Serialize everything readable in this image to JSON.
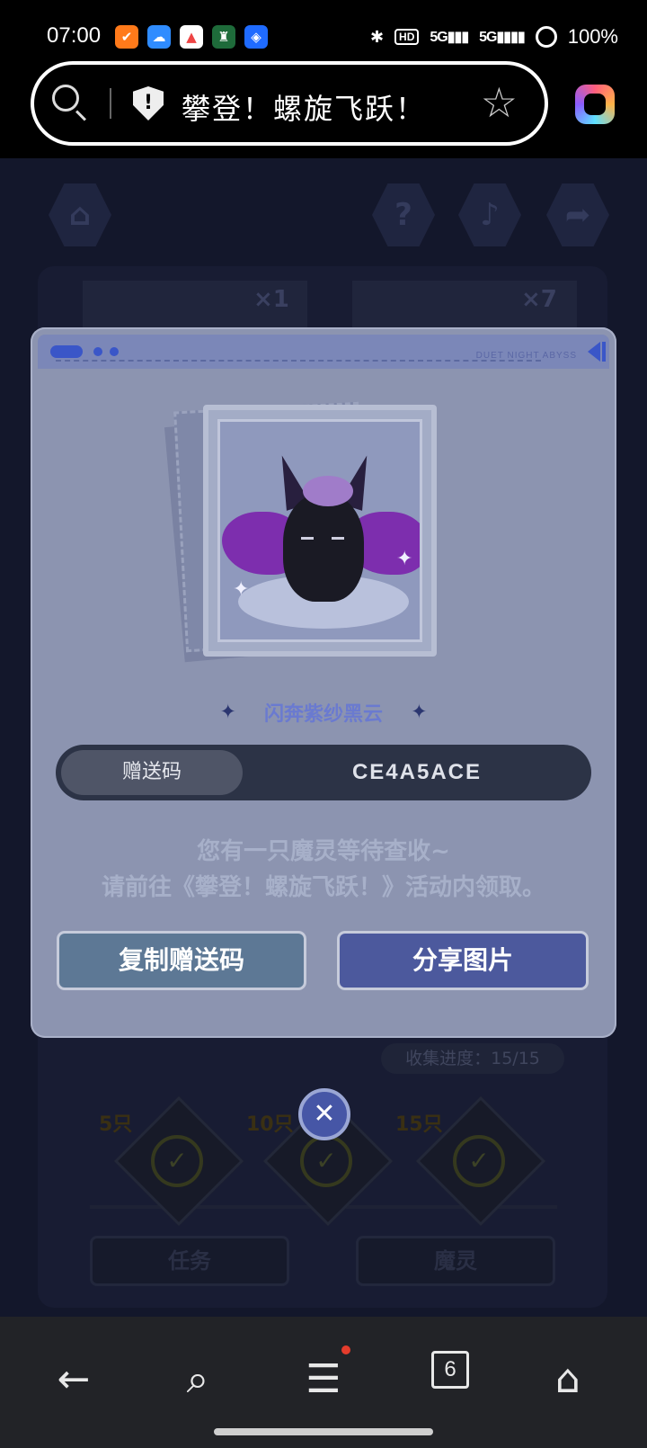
{
  "status": {
    "time": "07:00",
    "right_icons": [
      "bluetooth-icon",
      "hd-icon",
      "5g-signal-icon",
      "5g-signal-icon"
    ],
    "hd_label": "HD",
    "signal1": "5G",
    "signal2": "5G",
    "battery": "100%"
  },
  "browser": {
    "title": "攀登！螺旋飞跃！"
  },
  "game_bg": {
    "card1_badge": "×1",
    "card2_badge": "×7",
    "progress": "收集进度：15/15",
    "milestones": [
      "5只",
      "10只",
      "15只"
    ],
    "tab_task": "任务",
    "tab_spirit": "魔灵"
  },
  "modal": {
    "header_text": "DUET NIGHT ABYSS",
    "card_name": "闪奔紫纱黑云",
    "code_label": "赠送码",
    "code_value": "CE4A5ACE",
    "message_line1": "您有一只魔灵等待查收~",
    "message_line2": "请前往《攀登！螺旋飞跃！》活动内领取。",
    "copy_button": "复制赠送码",
    "share_button": "分享图片",
    "close_symbol": "✕"
  },
  "nav": {
    "tab_count": "6"
  },
  "colors": {
    "modal_bg": "#8c94b0",
    "share_button": "#4c599d",
    "copy_button": "#5d7895",
    "accent_blue": "#3a56c8"
  }
}
